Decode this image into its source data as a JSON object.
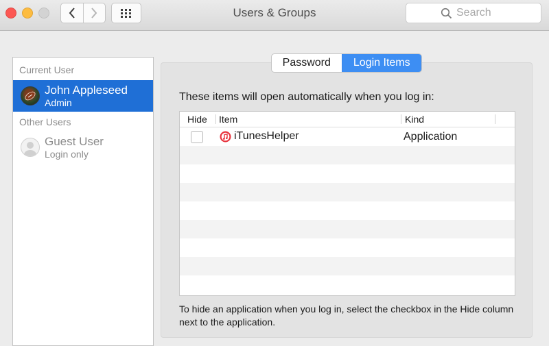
{
  "window": {
    "title": "Users & Groups"
  },
  "search": {
    "placeholder": "Search"
  },
  "sidebar": {
    "current_header": "Current User",
    "other_header": "Other Users",
    "users": [
      {
        "name": "John Appleseed",
        "role": "Admin",
        "selected": true
      },
      {
        "name": "Guest User",
        "role": "Login only",
        "selected": false
      }
    ]
  },
  "tabs": [
    {
      "label": "Password",
      "selected": false
    },
    {
      "label": "Login Items",
      "selected": true
    }
  ],
  "main": {
    "description": "These items will open automatically when you log in:",
    "footnote": "To hide an application when you log in, select the checkbox in the Hide column next to the application."
  },
  "table": {
    "columns": [
      "Hide",
      "Item",
      "Kind"
    ],
    "rows": [
      {
        "hide": false,
        "item": "iTunesHelper",
        "kind": "Application",
        "icon": "itunes-icon"
      }
    ]
  },
  "colors": {
    "selection": "#1f6fd6",
    "tab_selected": "#3d8ef3"
  }
}
